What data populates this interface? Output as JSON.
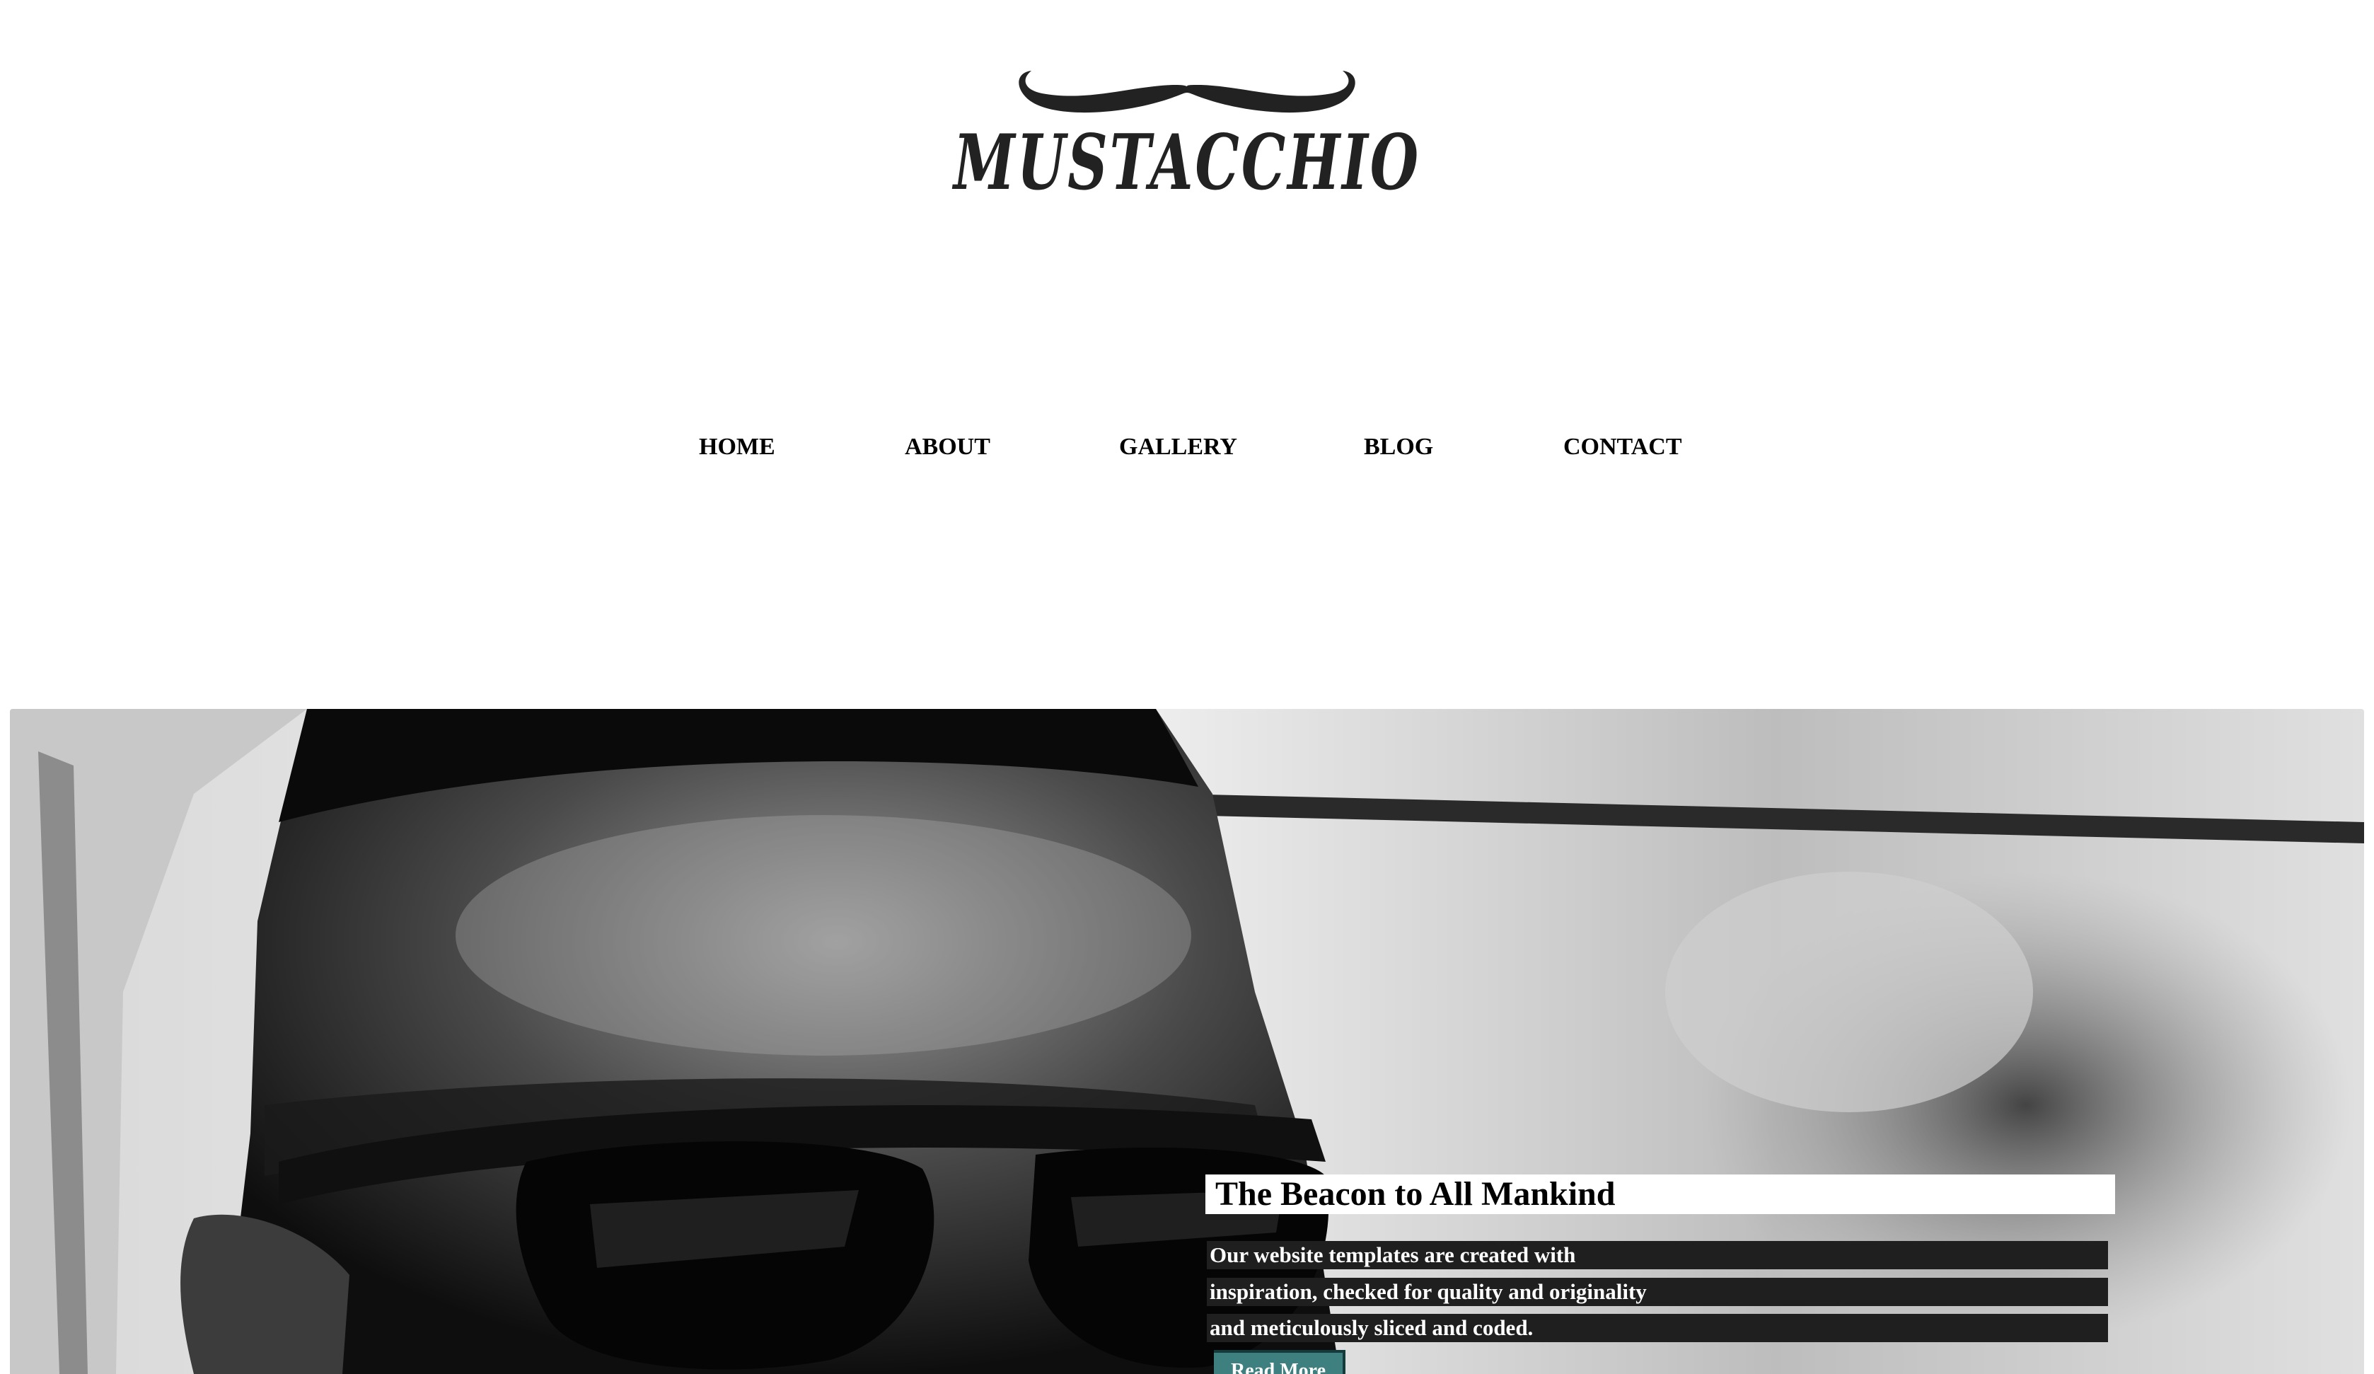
{
  "header": {
    "logo_text": "MUSTACCHIO"
  },
  "nav": {
    "items": [
      {
        "label": "HOME"
      },
      {
        "label": "ABOUT"
      },
      {
        "label": "GALLERY"
      },
      {
        "label": "BLOG"
      },
      {
        "label": "CONTACT"
      }
    ]
  },
  "hero": {
    "title": "The Beacon to All Mankind",
    "description_lines": [
      "Our website templates are created with",
      "inspiration, checked for quality and originality",
      "and meticulously sliced and coded."
    ],
    "button_label": "Read More"
  },
  "colors": {
    "background": "#ffffff",
    "text": "#000000",
    "caption_band": "#1f1f1f",
    "button": "#3e7f80",
    "logo": "#222222"
  },
  "icons": {
    "logo_mark": "mustache-icon"
  }
}
